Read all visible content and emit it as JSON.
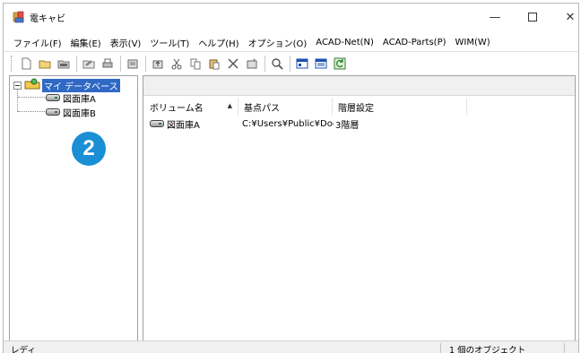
{
  "window": {
    "title": "電キャビ",
    "controls": {
      "minimize": "—",
      "close": "✕"
    }
  },
  "menu": [
    "ファイル(F)",
    "編集(E)",
    "表示(V)",
    "ツール(T)",
    "ヘルプ(H)",
    "オプション(O)",
    "ACAD-Net(N)",
    "ACAD-Parts(P)",
    "WIM(W)"
  ],
  "toolbar": {
    "icons": [
      "new-icon",
      "open-icon",
      "folder-icon",
      "open-folder-icon",
      "print-icon",
      "properties-icon",
      "upload-icon",
      "cut-icon",
      "copy-icon",
      "paste-icon",
      "delete-icon",
      "register-icon",
      "search-icon",
      "view-icon",
      "list-view-icon",
      "refresh-icon"
    ]
  },
  "tree": {
    "root_label": "マイ データベース",
    "children": [
      "図面庫A",
      "図面庫B"
    ]
  },
  "badge": "2",
  "list": {
    "columns": [
      "ボリューム名",
      "基点パス",
      "階層設定"
    ],
    "rows": [
      {
        "name": "図面庫A",
        "path": "C:¥Users¥Public¥Docu",
        "level": "3階層"
      }
    ]
  },
  "status": {
    "left": "レディ",
    "right": "1 個のオブジェクト"
  },
  "colors": {
    "selection": "#3069c4",
    "badge": "#1a8fd6"
  }
}
